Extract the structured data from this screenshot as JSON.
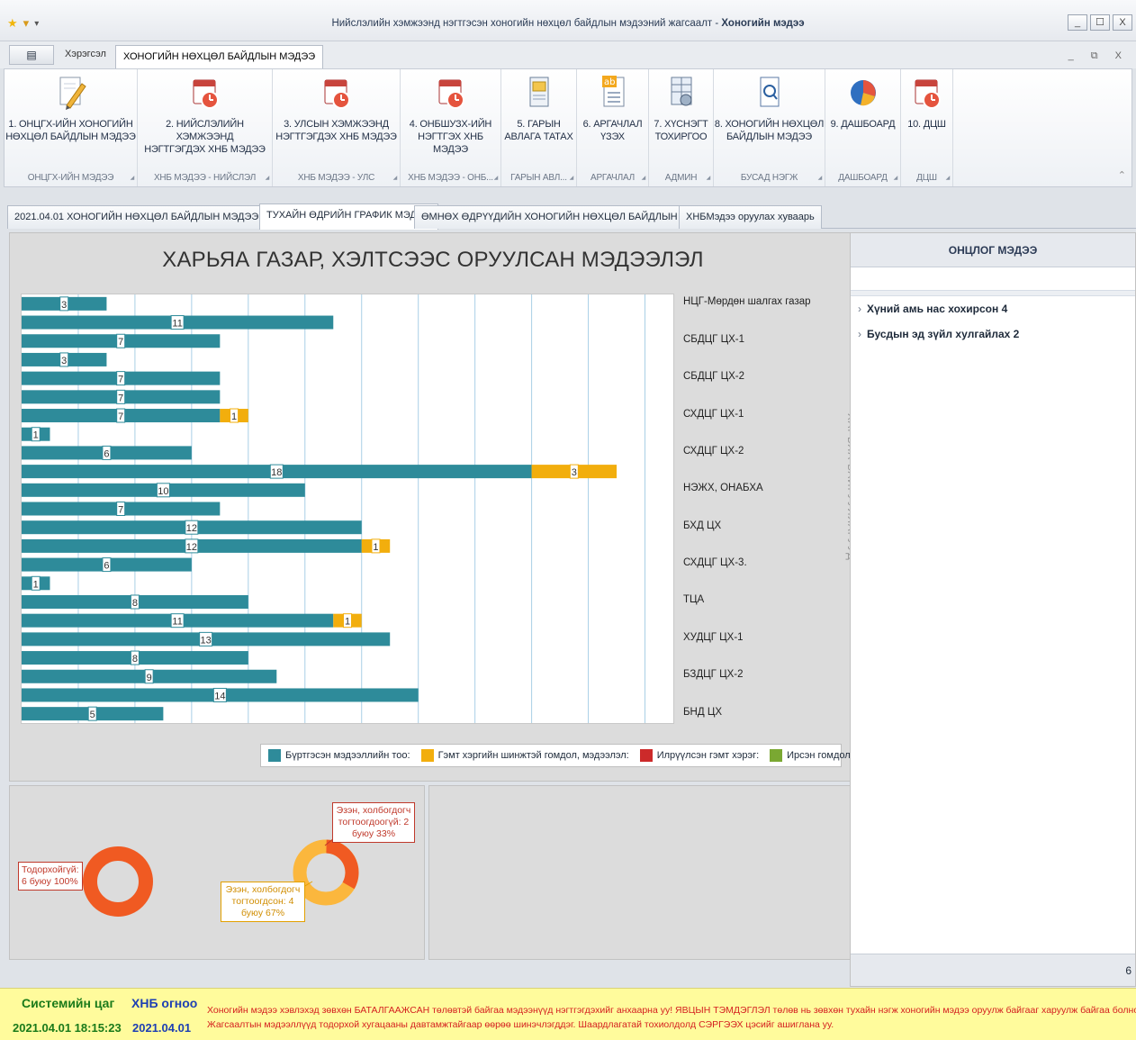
{
  "window": {
    "title_prefix": "Нийслэлийн хэмжээнд нэгтгэсэн хоногийн нөхцөл байдлын мэдээний жагсаалт - ",
    "title_bold": "Хоногийн мэдээ",
    "buttons": [
      "_",
      "☐",
      "X"
    ]
  },
  "ribbon_tabs": {
    "app_button": "▤",
    "tab1": "Хэрэгсэл",
    "tab2": "ХОНОГИЙН НӨХЦӨЛ БАЙДЛЫН МЭДЭЭ",
    "right_controls": "_ ⧉ X"
  },
  "ribbon": [
    {
      "label": "1. ОНЦГХ-ИЙН ХОНОГИЙН\nНӨХЦӨЛ БАЙДЛЫН МЭДЭЭ",
      "group": "ОНЦГХ-ИЙН МЭДЭЭ",
      "icon": "pencil-doc-icon"
    },
    {
      "label": "2. НИЙСЛЭЛИЙН ХЭМЖЭЭНД\nНЭГТГЭГДЭХ ХНБ МЭДЭЭ",
      "group": "ХНБ МЭДЭЭ - НИЙСЛЭЛ",
      "icon": "calendar-clock-icon"
    },
    {
      "label": "3. УЛСЫН ХЭМЖЭЭНД\nНЭГТГЭГДЭХ ХНБ МЭДЭЭ",
      "group": "ХНБ МЭДЭЭ - УЛС",
      "icon": "calendar-clock-icon"
    },
    {
      "label": "4. ОНБШУЗХ-ИЙН\nНЭГТГЭХ ХНБ МЭДЭЭ",
      "group": "ХНБ МЭДЭЭ - ОНБ...",
      "icon": "calendar-clock-icon"
    },
    {
      "label": "5. ГАРЫН\nАВЛАГА ТАТАХ",
      "group": "ГАРЫН АВЛ...",
      "icon": "manual-icon"
    },
    {
      "label": "6. АРГАЧЛАЛ\nҮЗЭХ",
      "group": "АРГАЧЛАЛ",
      "icon": "ab-doc-icon"
    },
    {
      "label": "7. ХҮСНЭГТ\nТОХИРГОО",
      "group": "АДМИН",
      "icon": "table-settings-icon"
    },
    {
      "label": "8. ХОНОГИЙН НӨХЦӨЛ\nБАЙДЛЫН МЭДЭЭ",
      "group": "БУСАД НЭГЖ",
      "icon": "doc-search-icon"
    },
    {
      "label": "9. ДАШБОАРД",
      "group": "ДАШБОАРД",
      "icon": "pie-chart-icon"
    },
    {
      "label": "10. ДЦШ",
      "group": "ДЦШ",
      "icon": "calendar-clock-icon"
    }
  ],
  "ribbon_collapse": "⌃",
  "doc_tabs": [
    "2021.04.01 ХОНОГИЙН НӨХЦӨЛ БАЙДЛЫН МЭДЭЭ",
    "ТУХАЙН ӨДРИЙН ГРАФИК МЭДЭЭ",
    "ӨМНӨХ ӨДРҮҮДИЙН ХОНОГИЙН НӨХЦӨЛ БАЙДЛЫН МЭДЭЭ",
    "ХНБМэдээ оруулах хуваарь"
  ],
  "chart_data": {
    "type": "bar",
    "orientation": "horizontal",
    "stacked": true,
    "title": "ХАРЬЯА ГАЗАР, ХЭЛТСЭЭС ОРУУЛСАН МЭДЭЭЛЭЛ",
    "ylabel": "ХАРЬЯА БАЙГУУЛЛАГУУД",
    "xlim": [
      0,
      23
    ],
    "grid": true,
    "legend_position": "bottom-right",
    "category_labels": [
      "НЦГ-Мөрдөн шалгах газар",
      "СБДЦГ ЦХ-1",
      "СБДЦГ ЦХ-2",
      "СХДЦГ ЦХ-1",
      "СХДЦГ ЦХ-2",
      "НЭЖХ, ОНАБХА",
      "БХД ЦХ",
      "СХДЦГ ЦХ-3.",
      "ТЦА",
      "ХУДЦГ ЦХ-1",
      "БЗДЦГ ЦХ-2",
      "БНД ЦХ"
    ],
    "series": [
      {
        "name": "Бүртгэсэн мэдээллийн тоо:",
        "color": "#2e8b9a",
        "values": [
          3,
          11,
          7,
          3,
          7,
          7,
          7,
          1,
          6,
          18,
          10,
          7,
          12,
          12,
          6,
          1,
          8,
          11,
          13,
          8,
          9,
          14,
          5
        ]
      },
      {
        "name": "Гэмт хэргийн шинжтэй гомдол, мэдээлэл:",
        "color": "#f2ae0d",
        "values": [
          0,
          0,
          0,
          0,
          0,
          0,
          1,
          0,
          0,
          3,
          0,
          0,
          0,
          1,
          0,
          0,
          0,
          1,
          0,
          0,
          0,
          0,
          0
        ]
      },
      {
        "name": "Илрүүлсэн гэмт хэрэг:",
        "color": "#cc2a2a",
        "values": [
          0,
          0,
          0,
          0,
          0,
          0,
          0,
          0,
          0,
          0,
          0,
          0,
          0,
          0,
          0,
          0,
          0,
          0,
          0,
          0,
          0,
          0,
          0
        ]
      },
      {
        "name": "Ирсэн гомдол, мэдээлэл:",
        "color": "#7aa832",
        "values": [
          0,
          0,
          0,
          0,
          0,
          0,
          0,
          0,
          0,
          0,
          0,
          0,
          0,
          0,
          0,
          0,
          0,
          0,
          0,
          0,
          0,
          0,
          0
        ]
      }
    ]
  },
  "donut1": {
    "label": "Тодорхойгүй:\n6 буюу 100%",
    "color": "#f05a22",
    "value": 6,
    "percent": 100
  },
  "donut2": {
    "slices": [
      {
        "label": "Эзэн, холбогдогч\nтогтоогдоогүй: 2\nбуюу 33%",
        "value": 2,
        "percent": 33,
        "color": "#f05a22"
      },
      {
        "label": "Эзэн, холбогдогч\nтогтоогдсон: 4\nбуюу 67%",
        "value": 4,
        "percent": 67,
        "color": "#fbb73d"
      }
    ]
  },
  "right_panel": {
    "title": "ОНЦЛОГ МЭДЭЭ",
    "items": [
      "Хүний амь нас хохирсон 4",
      "Бусдын эд зүйл хулгайлах 2"
    ],
    "footer": "6"
  },
  "status": {
    "sys_label": "Системийн цаг",
    "hnb_label": "ХНБ огноо",
    "sys_value": "2021.04.01 18:15:23",
    "hnb_value": "2021.04.01",
    "note1": "Хоногийн мэдээ хэвлэхэд зөвхөн БАТАЛГААЖСАН төлөвтэй байгаа мэдээнүүд нэгтгэгдэхийг анхаарна уу! ЯВЦЫН ТЭМДЭГЛЭЛ төлөв нь зөвхөн тухайн нэгж хоногийн мэдээ оруулж байгааг харуулж байгаа болно.",
    "note2": "Жагсаалтын мэдээллүүд тодорхой хугацааны давтамжтайгаар өөрөө шинэчлэгддэг. Шаардлагатай тохиолдолд СЭРГЭЭХ цэсийг ашиглана уу."
  }
}
